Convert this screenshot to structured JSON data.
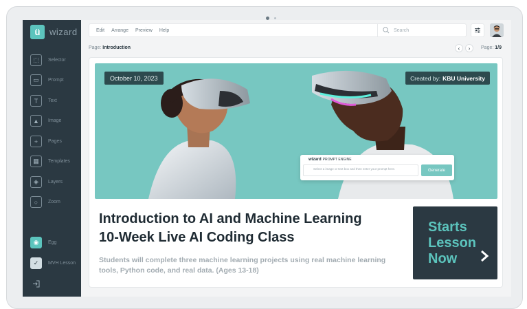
{
  "app": {
    "logo_letter": "ü",
    "logo_text": "wizard",
    "accent": "#5cc4bd",
    "sidebar_color": "#2b3942"
  },
  "sidebar": {
    "items": [
      {
        "label": "Selector",
        "icon": "selector-icon"
      },
      {
        "label": "Prompt",
        "icon": "prompt-icon"
      },
      {
        "label": "Text",
        "icon": "text-icon"
      },
      {
        "label": "Image",
        "icon": "image-icon"
      },
      {
        "label": "Pages",
        "icon": "pages-icon"
      },
      {
        "label": "Templates",
        "icon": "templates-icon"
      },
      {
        "label": "Layers",
        "icon": "layers-icon"
      },
      {
        "label": "Zoom",
        "icon": "zoom-icon"
      }
    ],
    "bottom_items": [
      {
        "label": "Egg",
        "icon": "egg-icon"
      },
      {
        "label": "MVH Lesson",
        "icon": "checkbox-icon"
      }
    ],
    "logout_icon": "logout-icon"
  },
  "toolbar": {
    "menu": [
      "Edit",
      "Arrange",
      "Preview",
      "Help"
    ],
    "search_placeholder": "Search"
  },
  "pagebar": {
    "label": "Page:",
    "page_name": "Introduction",
    "count_label": "Page:",
    "count": "1/9"
  },
  "slide": {
    "date": "October 10, 2023",
    "created_label": "Created by:",
    "created_by": "KBU University",
    "prompt_engine": {
      "brand": "wizard",
      "title": "PROMPT ENGINE",
      "placeholder": "Select a image or text box and then enter your prompt here.",
      "button": "Generate"
    },
    "title_line1": "Introduction to AI and Machine Learning",
    "title_line2": "10-Week Live AI Coding Class",
    "subtitle": "Students will complete three machine learning projects using real machine learning tools, Python code, and real data. (Ages 13-18)",
    "cta": {
      "line1": "Starts",
      "line2": "Lesson",
      "line3": "Now"
    }
  }
}
